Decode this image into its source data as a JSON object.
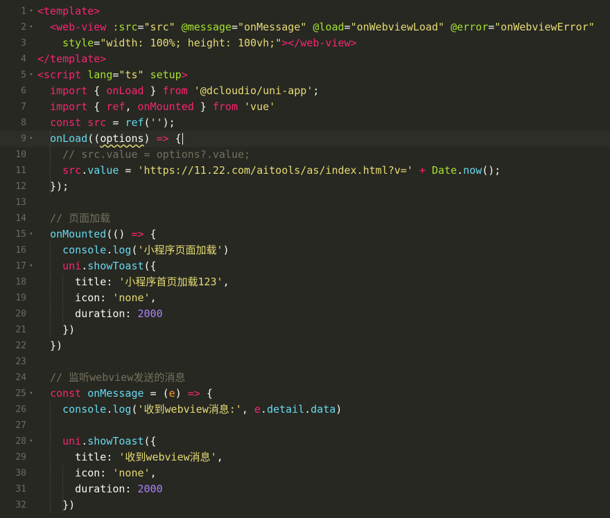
{
  "editor": {
    "lines": [
      {
        "n": "1",
        "fold": "▾",
        "tokens": [
          [
            "t-tag",
            "<template>"
          ]
        ]
      },
      {
        "n": "2",
        "fold": "▾",
        "tokens": [
          [
            "t-plain",
            "  "
          ],
          [
            "t-tag",
            "<web-view"
          ],
          [
            "t-plain",
            " "
          ],
          [
            "t-attr",
            ":src"
          ],
          [
            "t-plain",
            "="
          ],
          [
            "t-str",
            "\"src\""
          ],
          [
            "t-plain",
            " "
          ],
          [
            "t-attr",
            "@message"
          ],
          [
            "t-plain",
            "="
          ],
          [
            "t-str",
            "\"onMessage\""
          ],
          [
            "t-plain",
            " "
          ],
          [
            "t-attr",
            "@load"
          ],
          [
            "t-plain",
            "="
          ],
          [
            "t-str",
            "\"onWebviewLoad\""
          ],
          [
            "t-plain",
            " "
          ],
          [
            "t-attr",
            "@error"
          ],
          [
            "t-plain",
            "="
          ],
          [
            "t-str",
            "\"onWebviewError\""
          ]
        ]
      },
      {
        "n": "3",
        "fold": "",
        "tokens": [
          [
            "t-plain",
            "    "
          ],
          [
            "t-attr",
            "style"
          ],
          [
            "t-plain",
            "="
          ],
          [
            "t-str",
            "\"width: 100%; height: 100vh;\""
          ],
          [
            "t-tag",
            "></web-view>"
          ]
        ]
      },
      {
        "n": "4",
        "fold": "",
        "tokens": [
          [
            "t-tag",
            "</template>"
          ]
        ]
      },
      {
        "n": "5",
        "fold": "▾",
        "tokens": [
          [
            "t-tag",
            "<script"
          ],
          [
            "t-plain",
            " "
          ],
          [
            "t-attr",
            "lang"
          ],
          [
            "t-plain",
            "="
          ],
          [
            "t-str",
            "\"ts\""
          ],
          [
            "t-plain",
            " "
          ],
          [
            "t-attr",
            "setup"
          ],
          [
            "t-tag",
            ">"
          ]
        ]
      },
      {
        "n": "6",
        "fold": "",
        "tokens": [
          [
            "t-plain",
            "  "
          ],
          [
            "t-kw",
            "import"
          ],
          [
            "t-plain",
            " { "
          ],
          [
            "t-var",
            "onLoad"
          ],
          [
            "t-plain",
            " } "
          ],
          [
            "t-kw",
            "from"
          ],
          [
            "t-plain",
            " "
          ],
          [
            "t-str",
            "'@dcloudio/uni-app'"
          ],
          [
            "t-plain",
            ";"
          ]
        ]
      },
      {
        "n": "7",
        "fold": "",
        "tokens": [
          [
            "t-plain",
            "  "
          ],
          [
            "t-kw",
            "import"
          ],
          [
            "t-plain",
            " { "
          ],
          [
            "t-var",
            "ref"
          ],
          [
            "t-plain",
            ", "
          ],
          [
            "t-var",
            "onMounted"
          ],
          [
            "t-plain",
            " } "
          ],
          [
            "t-kw",
            "from"
          ],
          [
            "t-plain",
            " "
          ],
          [
            "t-str",
            "'vue'"
          ]
        ]
      },
      {
        "n": "8",
        "fold": "",
        "tokens": [
          [
            "t-plain",
            "  "
          ],
          [
            "t-kw",
            "const"
          ],
          [
            "t-plain",
            " "
          ],
          [
            "t-var",
            "src"
          ],
          [
            "t-plain",
            " = "
          ],
          [
            "t-fn",
            "ref"
          ],
          [
            "t-plain",
            "("
          ],
          [
            "t-str",
            "''"
          ],
          [
            "t-plain",
            ");"
          ]
        ]
      },
      {
        "n": "9",
        "fold": "▾",
        "active": true,
        "tokens": [
          [
            "t-plain",
            "  "
          ],
          [
            "t-fn",
            "onLoad"
          ],
          [
            "t-plain",
            "(("
          ],
          [
            "t-squiggle",
            "options"
          ],
          [
            "t-plain",
            ") "
          ],
          [
            "t-kw",
            "=>"
          ],
          [
            "t-plain",
            " {"
          ]
        ],
        "cursor": true
      },
      {
        "n": "10",
        "fold": "",
        "tokens": [
          [
            "t-plain",
            "    "
          ],
          [
            "t-comment",
            "// src.value = options?.value;"
          ]
        ]
      },
      {
        "n": "11",
        "fold": "",
        "tokens": [
          [
            "t-plain",
            "    "
          ],
          [
            "t-var",
            "src"
          ],
          [
            "t-plain",
            "."
          ],
          [
            "t-fn",
            "value"
          ],
          [
            "t-plain",
            " = "
          ],
          [
            "t-str",
            "'https://11.22.com/aitools/as/index.html?v='"
          ],
          [
            "t-plain",
            " "
          ],
          [
            "t-kw",
            "+"
          ],
          [
            "t-plain",
            " "
          ],
          [
            "t-cls",
            "Date"
          ],
          [
            "t-plain",
            "."
          ],
          [
            "t-fn",
            "now"
          ],
          [
            "t-plain",
            "();"
          ]
        ]
      },
      {
        "n": "12",
        "fold": "",
        "tokens": [
          [
            "t-plain",
            "  });"
          ]
        ]
      },
      {
        "n": "13",
        "fold": "",
        "tokens": []
      },
      {
        "n": "14",
        "fold": "",
        "tokens": [
          [
            "t-plain",
            "  "
          ],
          [
            "t-comment",
            "// 页面加载"
          ]
        ]
      },
      {
        "n": "15",
        "fold": "▾",
        "tokens": [
          [
            "t-plain",
            "  "
          ],
          [
            "t-fn",
            "onMounted"
          ],
          [
            "t-plain",
            "(() "
          ],
          [
            "t-kw",
            "=>"
          ],
          [
            "t-plain",
            " {"
          ]
        ]
      },
      {
        "n": "16",
        "fold": "",
        "tokens": [
          [
            "t-plain",
            "    "
          ],
          [
            "t-fn",
            "console"
          ],
          [
            "t-plain",
            "."
          ],
          [
            "t-fn",
            "log"
          ],
          [
            "t-plain",
            "("
          ],
          [
            "t-str",
            "'小程序页面加载'"
          ],
          [
            "t-plain",
            ")"
          ]
        ]
      },
      {
        "n": "17",
        "fold": "▾",
        "tokens": [
          [
            "t-plain",
            "    "
          ],
          [
            "t-var",
            "uni"
          ],
          [
            "t-plain",
            "."
          ],
          [
            "t-fn",
            "showToast"
          ],
          [
            "t-plain",
            "({"
          ]
        ]
      },
      {
        "n": "18",
        "fold": "",
        "tokens": [
          [
            "t-plain",
            "      title: "
          ],
          [
            "t-str",
            "'小程序首页加载123'"
          ],
          [
            "t-plain",
            ","
          ]
        ]
      },
      {
        "n": "19",
        "fold": "",
        "tokens": [
          [
            "t-plain",
            "      icon: "
          ],
          [
            "t-str",
            "'none'"
          ],
          [
            "t-plain",
            ","
          ]
        ]
      },
      {
        "n": "20",
        "fold": "",
        "tokens": [
          [
            "t-plain",
            "      duration: "
          ],
          [
            "t-num",
            "2000"
          ]
        ]
      },
      {
        "n": "21",
        "fold": "",
        "tokens": [
          [
            "t-plain",
            "    })"
          ]
        ]
      },
      {
        "n": "22",
        "fold": "",
        "tokens": [
          [
            "t-plain",
            "  })"
          ]
        ]
      },
      {
        "n": "23",
        "fold": "",
        "tokens": []
      },
      {
        "n": "24",
        "fold": "",
        "tokens": [
          [
            "t-plain",
            "  "
          ],
          [
            "t-comment",
            "// 监听webview发送的消息"
          ]
        ]
      },
      {
        "n": "25",
        "fold": "▾",
        "tokens": [
          [
            "t-plain",
            "  "
          ],
          [
            "t-kw",
            "const"
          ],
          [
            "t-plain",
            " "
          ],
          [
            "t-fn",
            "onMessage"
          ],
          [
            "t-plain",
            " = ("
          ],
          [
            "t-param",
            "e"
          ],
          [
            "t-plain",
            ") "
          ],
          [
            "t-kw",
            "=>"
          ],
          [
            "t-plain",
            " {"
          ]
        ]
      },
      {
        "n": "26",
        "fold": "",
        "tokens": [
          [
            "t-plain",
            "    "
          ],
          [
            "t-fn",
            "console"
          ],
          [
            "t-plain",
            "."
          ],
          [
            "t-fn",
            "log"
          ],
          [
            "t-plain",
            "("
          ],
          [
            "t-str",
            "'收到webview消息:'"
          ],
          [
            "t-plain",
            ", "
          ],
          [
            "t-var",
            "e"
          ],
          [
            "t-plain",
            "."
          ],
          [
            "t-fn",
            "detail"
          ],
          [
            "t-plain",
            "."
          ],
          [
            "t-fn",
            "data"
          ],
          [
            "t-plain",
            ")"
          ]
        ]
      },
      {
        "n": "27",
        "fold": "",
        "tokens": []
      },
      {
        "n": "28",
        "fold": "▾",
        "tokens": [
          [
            "t-plain",
            "    "
          ],
          [
            "t-var",
            "uni"
          ],
          [
            "t-plain",
            "."
          ],
          [
            "t-fn",
            "showToast"
          ],
          [
            "t-plain",
            "({"
          ]
        ]
      },
      {
        "n": "29",
        "fold": "",
        "tokens": [
          [
            "t-plain",
            "      title: "
          ],
          [
            "t-str",
            "'收到webview消息'"
          ],
          [
            "t-plain",
            ","
          ]
        ]
      },
      {
        "n": "30",
        "fold": "",
        "tokens": [
          [
            "t-plain",
            "      icon: "
          ],
          [
            "t-str",
            "'none'"
          ],
          [
            "t-plain",
            ","
          ]
        ]
      },
      {
        "n": "31",
        "fold": "",
        "tokens": [
          [
            "t-plain",
            "      duration: "
          ],
          [
            "t-num",
            "2000"
          ]
        ]
      },
      {
        "n": "32",
        "fold": "",
        "tokens": [
          [
            "t-plain",
            "    })"
          ]
        ]
      }
    ]
  },
  "colors": {
    "background": "#272822",
    "active_line": "#2d2e28",
    "tag": "#f92672",
    "attribute": "#a6e22e",
    "string": "#e6db74",
    "function": "#66d9ef",
    "number": "#ae81ff",
    "comment": "#75715e"
  }
}
